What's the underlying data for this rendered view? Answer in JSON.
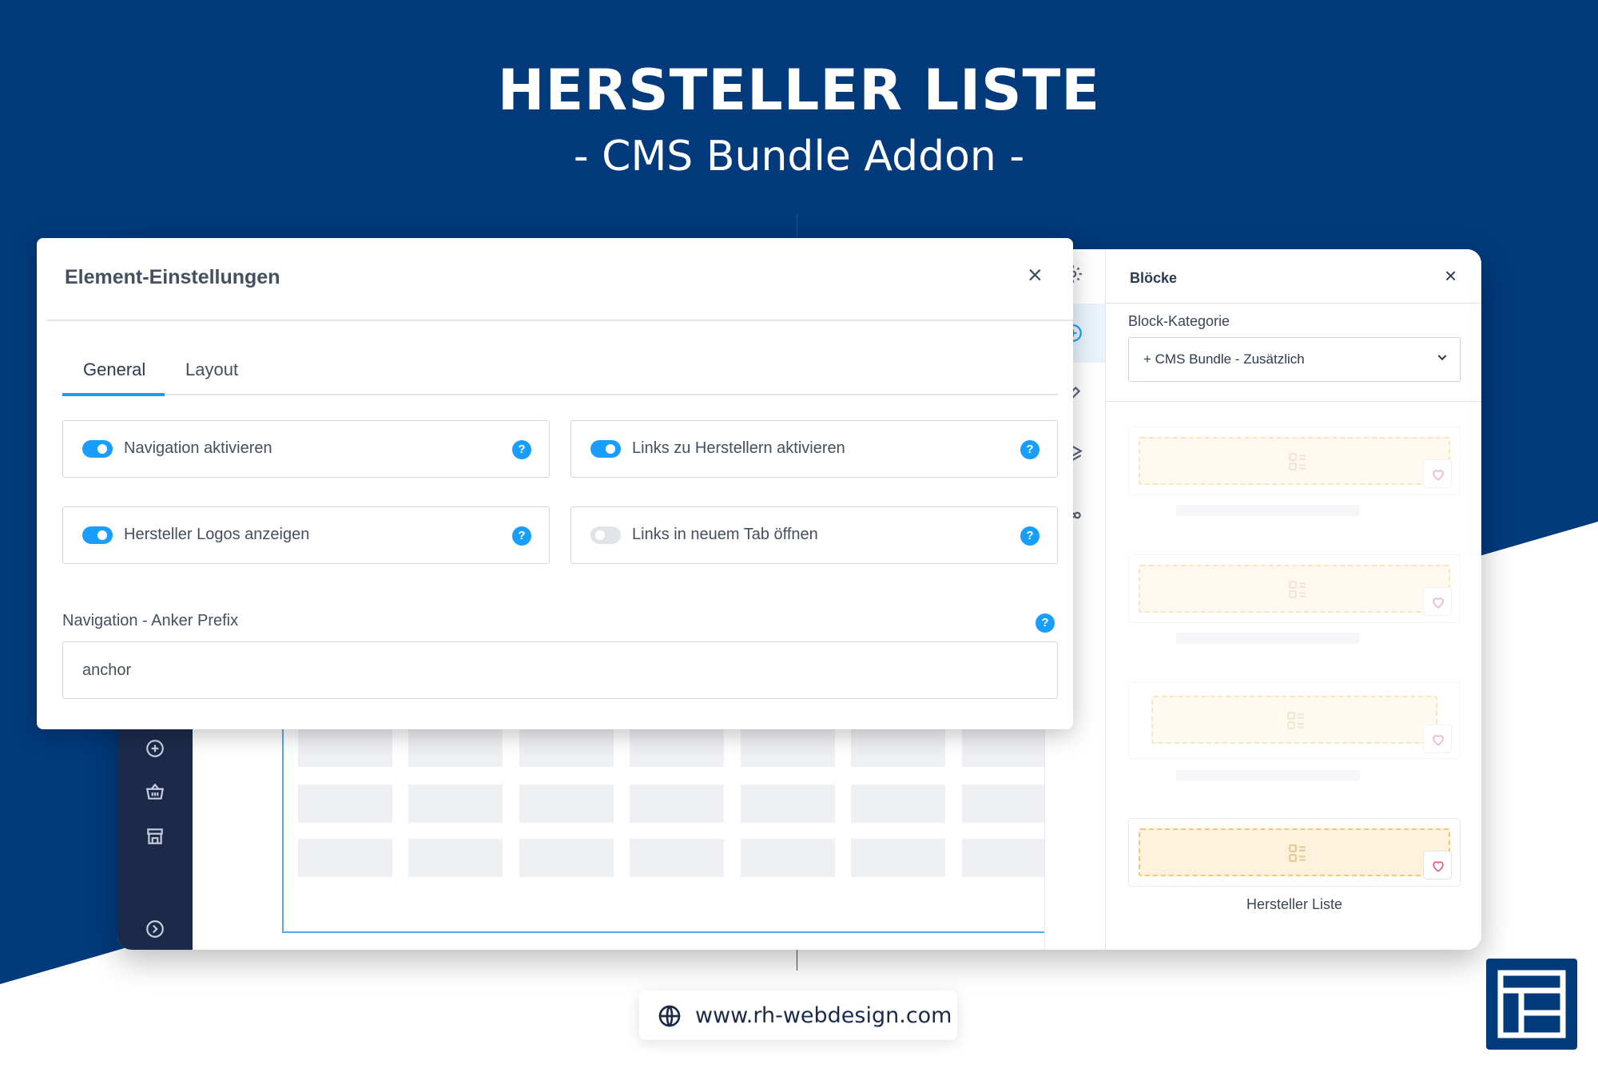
{
  "hero": {
    "title": "HERSTELLER LISTE",
    "subtitle": "- CMS Bundle Addon -"
  },
  "modal": {
    "title": "Element-Einstellungen",
    "close_label": "×",
    "tabs": [
      {
        "label": "General",
        "active": true
      },
      {
        "label": "Layout",
        "active": false
      }
    ],
    "options": [
      {
        "label": "Navigation aktivieren",
        "enabled": true,
        "help": "?"
      },
      {
        "label": "Links zu Herstellern aktivieren",
        "enabled": true,
        "help": "?"
      },
      {
        "label": "Hersteller Logos anzeigen",
        "enabled": true,
        "help": "?"
      },
      {
        "label": "Links in neuem Tab öffnen",
        "enabled": false,
        "help": "?"
      }
    ],
    "anchor_field": {
      "label": "Navigation - Anker Prefix",
      "help": "?",
      "value": "anchor"
    }
  },
  "blocks_panel": {
    "title": "Blöcke",
    "close_label": "×",
    "category_label": "Block-Kategorie",
    "category_value": "+ CMS Bundle - Zusätzlich",
    "cards": [
      {
        "label": ""
      },
      {
        "label": ""
      },
      {
        "label": ""
      },
      {
        "label": "Hersteller Liste"
      }
    ]
  },
  "footer": {
    "url": "www.rh-webdesign.com"
  },
  "colors": {
    "brand_blue": "#023a7c",
    "accent": "#189eff",
    "sidebar": "#1c2a4a",
    "block_fill": "#fff2dc",
    "block_border": "#f5c873"
  }
}
